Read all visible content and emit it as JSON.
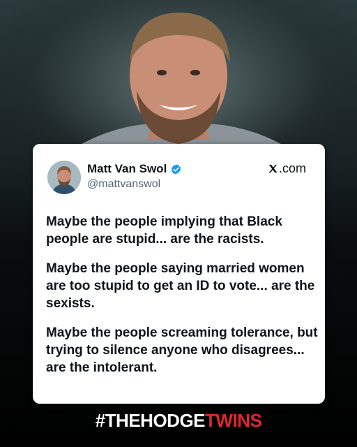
{
  "tweet": {
    "name": "Matt Van Swol",
    "handle": "@mattvanswol",
    "site": ".com",
    "site_icon": "x-logo-icon",
    "verified_icon": "verified-badge-icon",
    "verified_color": "#1d9bf0",
    "paragraphs": [
      "Maybe the people implying that Black people are stupid... are the racists.",
      "Maybe the people saying married women are too stupid to get an ID to vote... are the sexists.",
      "Maybe the people screaming tolerance, but trying to silence anyone who disagrees... are the intolerant."
    ]
  },
  "brand": {
    "part1": "#THEHODGE",
    "part2": "TWINS",
    "accent_color": "#e0262d"
  }
}
